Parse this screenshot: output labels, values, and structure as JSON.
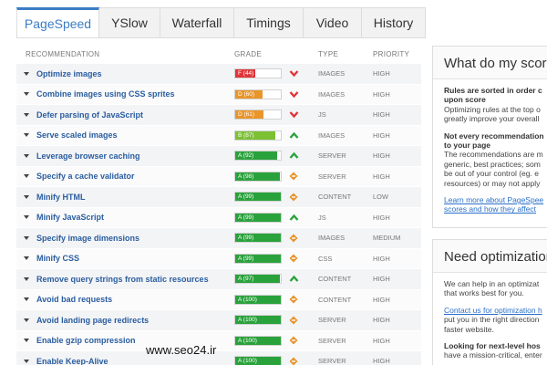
{
  "tabs": [
    {
      "label": "PageSpeed",
      "active": true
    },
    {
      "label": "YSlow",
      "active": false
    },
    {
      "label": "Waterfall",
      "active": false
    },
    {
      "label": "Timings",
      "active": false
    },
    {
      "label": "Video",
      "active": false
    },
    {
      "label": "History",
      "active": false
    }
  ],
  "table": {
    "headers": {
      "recommendation": "RECOMMENDATION",
      "grade": "GRADE",
      "type": "TYPE",
      "priority": "PRIORITY"
    },
    "rows": [
      {
        "name": "Optimize images",
        "grade_text": "F (44)",
        "score": 44,
        "color": "#e0353a",
        "icon": "chevron-down-icon",
        "type": "IMAGES",
        "priority": "HIGH"
      },
      {
        "name": "Combine images using CSS sprites",
        "grade_text": "D (60)",
        "score": 60,
        "color": "#e8952a",
        "icon": "chevron-down-icon",
        "type": "IMAGES",
        "priority": "HIGH"
      },
      {
        "name": "Defer parsing of JavaScript",
        "grade_text": "D (61)",
        "score": 61,
        "color": "#e8952a",
        "icon": "chevron-down-icon",
        "type": "JS",
        "priority": "HIGH"
      },
      {
        "name": "Serve scaled images",
        "grade_text": "B (87)",
        "score": 87,
        "color": "#7cc034",
        "icon": "chevron-up-icon",
        "type": "IMAGES",
        "priority": "HIGH"
      },
      {
        "name": "Leverage browser caching",
        "grade_text": "A (92)",
        "score": 92,
        "color": "#2aa23c",
        "icon": "chevron-up-icon",
        "type": "SERVER",
        "priority": "HIGH"
      },
      {
        "name": "Specify a cache validator",
        "grade_text": "A (98)",
        "score": 98,
        "color": "#2aa23c",
        "icon": "diamond-icon",
        "type": "SERVER",
        "priority": "HIGH"
      },
      {
        "name": "Minify HTML",
        "grade_text": "A (99)",
        "score": 99,
        "color": "#2aa23c",
        "icon": "diamond-icon",
        "type": "CONTENT",
        "priority": "LOW"
      },
      {
        "name": "Minify JavaScript",
        "grade_text": "A (99)",
        "score": 99,
        "color": "#2aa23c",
        "icon": "chevron-up-icon",
        "type": "JS",
        "priority": "HIGH"
      },
      {
        "name": "Specify image dimensions",
        "grade_text": "A (99)",
        "score": 99,
        "color": "#2aa23c",
        "icon": "diamond-icon",
        "type": "IMAGES",
        "priority": "MEDIUM"
      },
      {
        "name": "Minify CSS",
        "grade_text": "A (99)",
        "score": 99,
        "color": "#2aa23c",
        "icon": "diamond-icon",
        "type": "CSS",
        "priority": "HIGH"
      },
      {
        "name": "Remove query strings from static resources",
        "grade_text": "A (97)",
        "score": 97,
        "color": "#2aa23c",
        "icon": "chevron-up-icon",
        "type": "CONTENT",
        "priority": "HIGH"
      },
      {
        "name": "Avoid bad requests",
        "grade_text": "A (100)",
        "score": 100,
        "color": "#2aa23c",
        "icon": "diamond-icon",
        "type": "CONTENT",
        "priority": "HIGH"
      },
      {
        "name": "Avoid landing page redirects",
        "grade_text": "A (100)",
        "score": 100,
        "color": "#2aa23c",
        "icon": "diamond-icon",
        "type": "SERVER",
        "priority": "HIGH"
      },
      {
        "name": "Enable gzip compression",
        "grade_text": "A (100)",
        "score": 100,
        "color": "#2aa23c",
        "icon": "diamond-icon",
        "type": "SERVER",
        "priority": "HIGH"
      },
      {
        "name": "Enable Keep-Alive",
        "grade_text": "A (100)",
        "score": 100,
        "color": "#2aa23c",
        "icon": "diamond-icon",
        "type": "SERVER",
        "priority": "HIGH"
      }
    ]
  },
  "panel1": {
    "title": "What do my scores",
    "lines": [
      {
        "text": "Rules are sorted in order c",
        "style": "b"
      },
      {
        "text": "upon score",
        "style": "b"
      },
      {
        "text": "Optimizing rules at the top o",
        "style": ""
      },
      {
        "text": "greatly improve your overall",
        "style": ""
      },
      {
        "text": "",
        "style": "gap"
      },
      {
        "text": "Not every recommendation",
        "style": "b"
      },
      {
        "text": "to your page",
        "style": "b"
      },
      {
        "text": "The recommendations are m",
        "style": ""
      },
      {
        "text": "generic, best practices; som",
        "style": ""
      },
      {
        "text": "be out of your control (eg. e",
        "style": ""
      },
      {
        "text": "resources) or may not apply",
        "style": ""
      },
      {
        "text": "",
        "style": "gap"
      },
      {
        "text": "Learn more about PageSpee",
        "style": "lnk"
      },
      {
        "text": "scores and how they affect",
        "style": "lnk"
      }
    ]
  },
  "panel2": {
    "title": "Need optimization",
    "lines": [
      {
        "text": "We can help in an optimizat",
        "style": ""
      },
      {
        "text": "that works best for you.",
        "style": ""
      },
      {
        "text": "",
        "style": "gap"
      },
      {
        "text": "Contact us for optimization h",
        "style": "lnk"
      },
      {
        "text": "put you in the right direction",
        "style": ""
      },
      {
        "text": "faster website.",
        "style": ""
      },
      {
        "text": "",
        "style": "gap"
      },
      {
        "text": "Looking for next-level hos",
        "style": "b"
      },
      {
        "text": "have a mission-critical, enter",
        "style": ""
      }
    ]
  },
  "watermark": "www.seo24.ir",
  "colors": {
    "accent": "#3b7dc4",
    "link": "#2a5d9f",
    "up": "#2aa23c",
    "down": "#e0353a",
    "neutral": "#e8952a"
  }
}
